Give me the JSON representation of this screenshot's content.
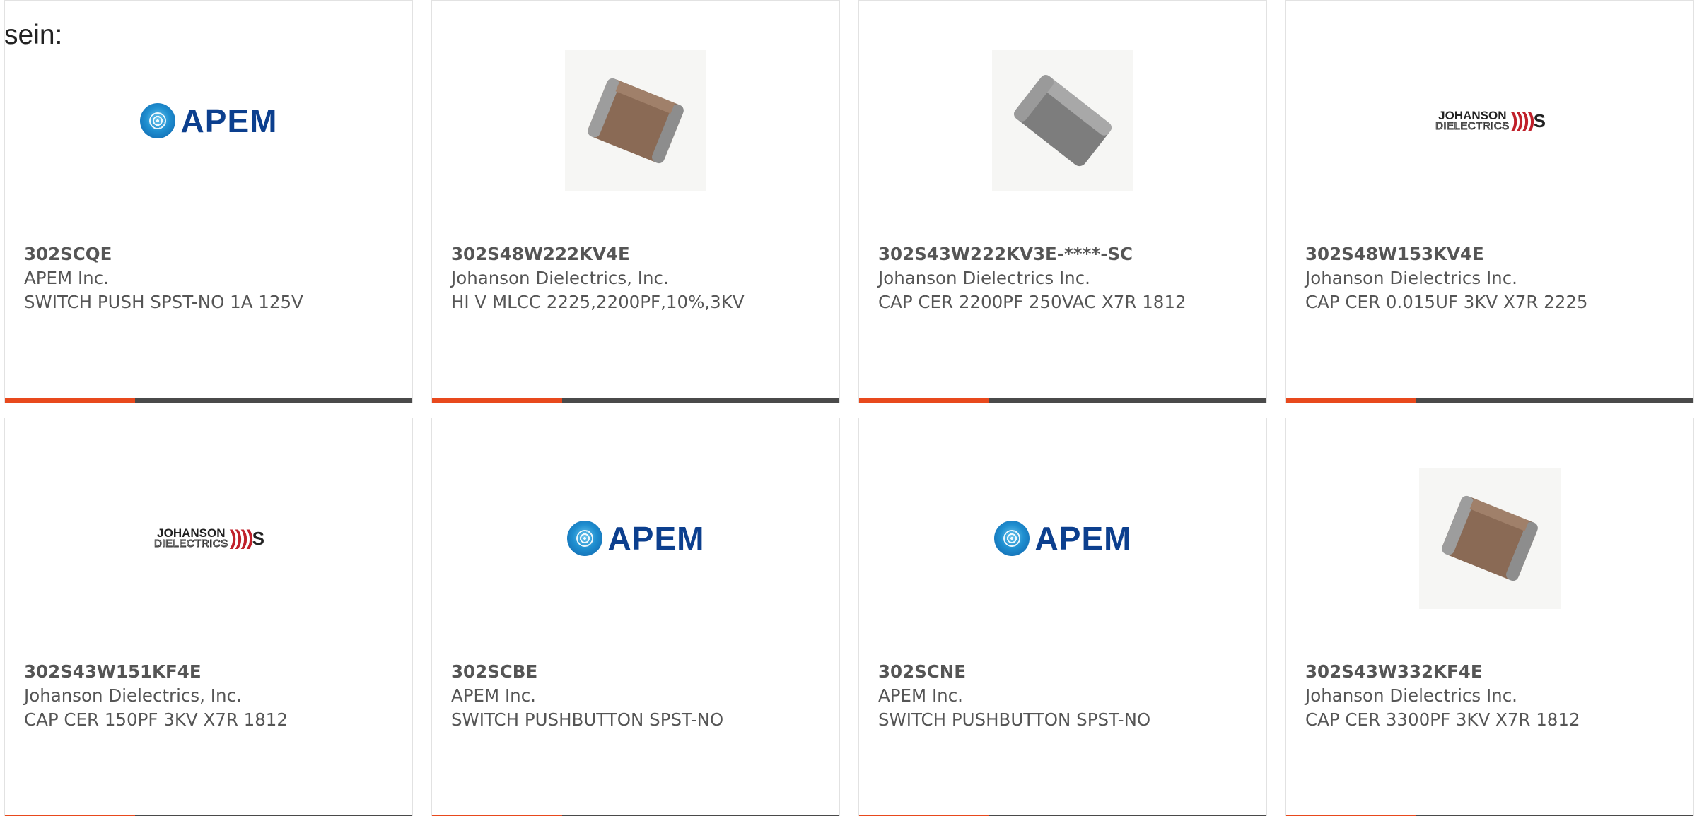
{
  "intro_text": "sein:",
  "colors": {
    "accent": "#e8491d",
    "bar": "#4a4a4a"
  },
  "products": [
    {
      "part_number": "302SCQE",
      "manufacturer": "APEM Inc.",
      "description": "SWITCH PUSH SPST-NO 1A 125V",
      "image": "apem-logo"
    },
    {
      "part_number": "302S48W222KV4E",
      "manufacturer": "Johanson Dielectrics, Inc.",
      "description": "HI V MLCC 2225,2200PF,10%,3KV",
      "image": "capacitor-photo-brown"
    },
    {
      "part_number": "302S43W222KV3E-****-SC",
      "manufacturer": "Johanson Dielectrics Inc.",
      "description": "CAP CER 2200PF 250VAC X7R 1812",
      "image": "capacitor-photo-gray"
    },
    {
      "part_number": "302S48W153KV4E",
      "manufacturer": "Johanson Dielectrics Inc.",
      "description": "CAP CER 0.015UF 3KV X7R 2225",
      "image": "johanson-logo"
    },
    {
      "part_number": "302S43W151KF4E",
      "manufacturer": "Johanson Dielectrics, Inc.",
      "description": "CAP CER 150PF 3KV X7R 1812",
      "image": "johanson-logo"
    },
    {
      "part_number": "302SCBE",
      "manufacturer": "APEM Inc.",
      "description": "SWITCH PUSHBUTTON SPST-NO",
      "image": "apem-logo"
    },
    {
      "part_number": "302SCNE",
      "manufacturer": "APEM Inc.",
      "description": "SWITCH PUSHBUTTON SPST-NO",
      "image": "apem-logo"
    },
    {
      "part_number": "302S43W332KF4E",
      "manufacturer": "Johanson Dielectrics Inc.",
      "description": "CAP CER 3300PF 3KV X7R 1812",
      "image": "capacitor-photo-brown"
    }
  ],
  "logos": {
    "apem": "APEM",
    "johanson_line1": "JOHANSON",
    "johanson_line2": "DIELECTRICS"
  }
}
